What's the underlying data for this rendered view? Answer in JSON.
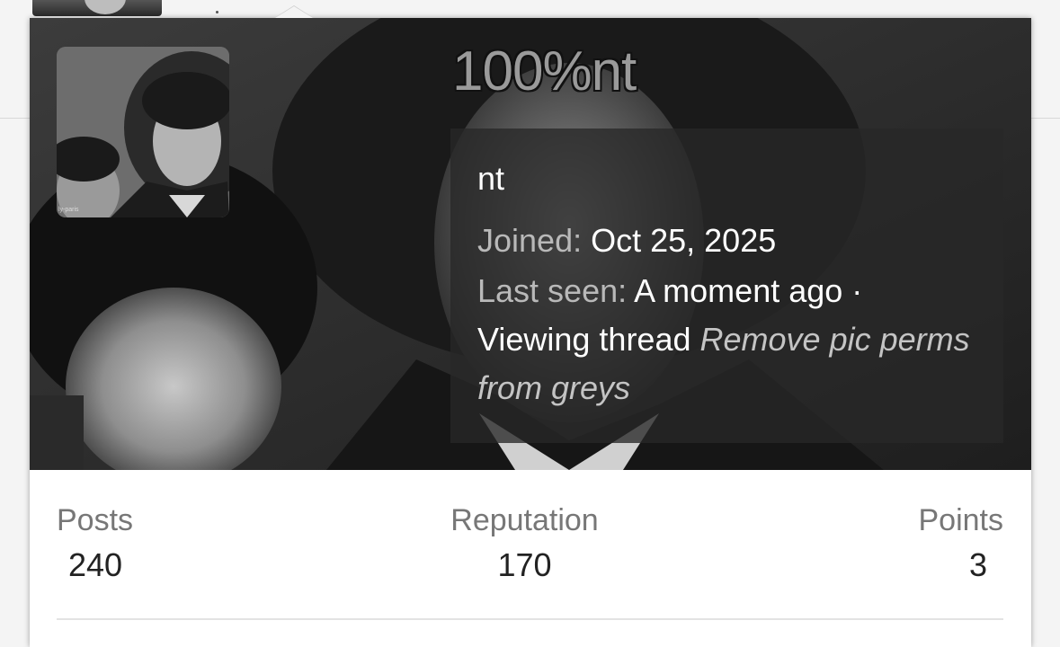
{
  "profile": {
    "username": "100%nt",
    "title": "nt",
    "joined_label": "Joined:",
    "joined_value": "Oct 25, 2025",
    "last_seen_label": "Last seen:",
    "last_seen_value": "A moment ago ·",
    "activity_text": "Viewing thread",
    "activity_thread": "Remove pic perms from greys",
    "avatar_caption": "ly-paris"
  },
  "stats": {
    "posts_label": "Posts",
    "posts_value": "240",
    "reputation_label": "Reputation",
    "reputation_value": "170",
    "points_label": "Points",
    "points_value": "3"
  },
  "colors": {
    "banner_bg": "#2b2b2b",
    "info_box_bg": "rgba(40,40,40,0.78)",
    "muted_text": "#b9b9b9",
    "stat_label": "#777777"
  }
}
